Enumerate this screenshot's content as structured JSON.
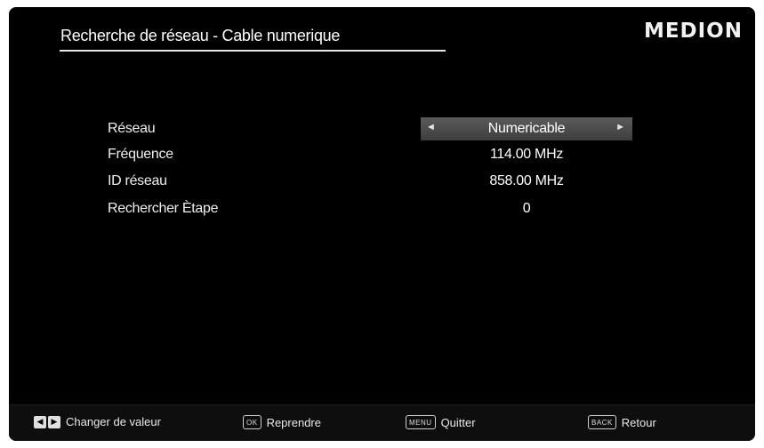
{
  "header": {
    "title": "Recherche de réseau - Cable numerique",
    "brand": "MEDION"
  },
  "settings": [
    {
      "label": "Réseau",
      "value": "Numericable",
      "selector": true
    },
    {
      "label": "Fréquence",
      "value": "114.00 MHz"
    },
    {
      "label": "ID réseau",
      "value": "858.00 MHz"
    },
    {
      "label": "Rechercher Ètape",
      "value": "0"
    }
  ],
  "footer": {
    "change": {
      "text": "Changer de valeur"
    },
    "ok": {
      "key": "OK",
      "text": "Reprendre"
    },
    "menu": {
      "key": "MENU",
      "text": "Quitter"
    },
    "back": {
      "key": "BACK",
      "text": "Retour"
    }
  },
  "colors": {
    "background": "#000000",
    "selected_field": "#4d4d4d",
    "text": "#ffffff"
  },
  "icons": {
    "left_arrow": "left-arrow-icon",
    "right_arrow": "right-arrow-icon"
  }
}
